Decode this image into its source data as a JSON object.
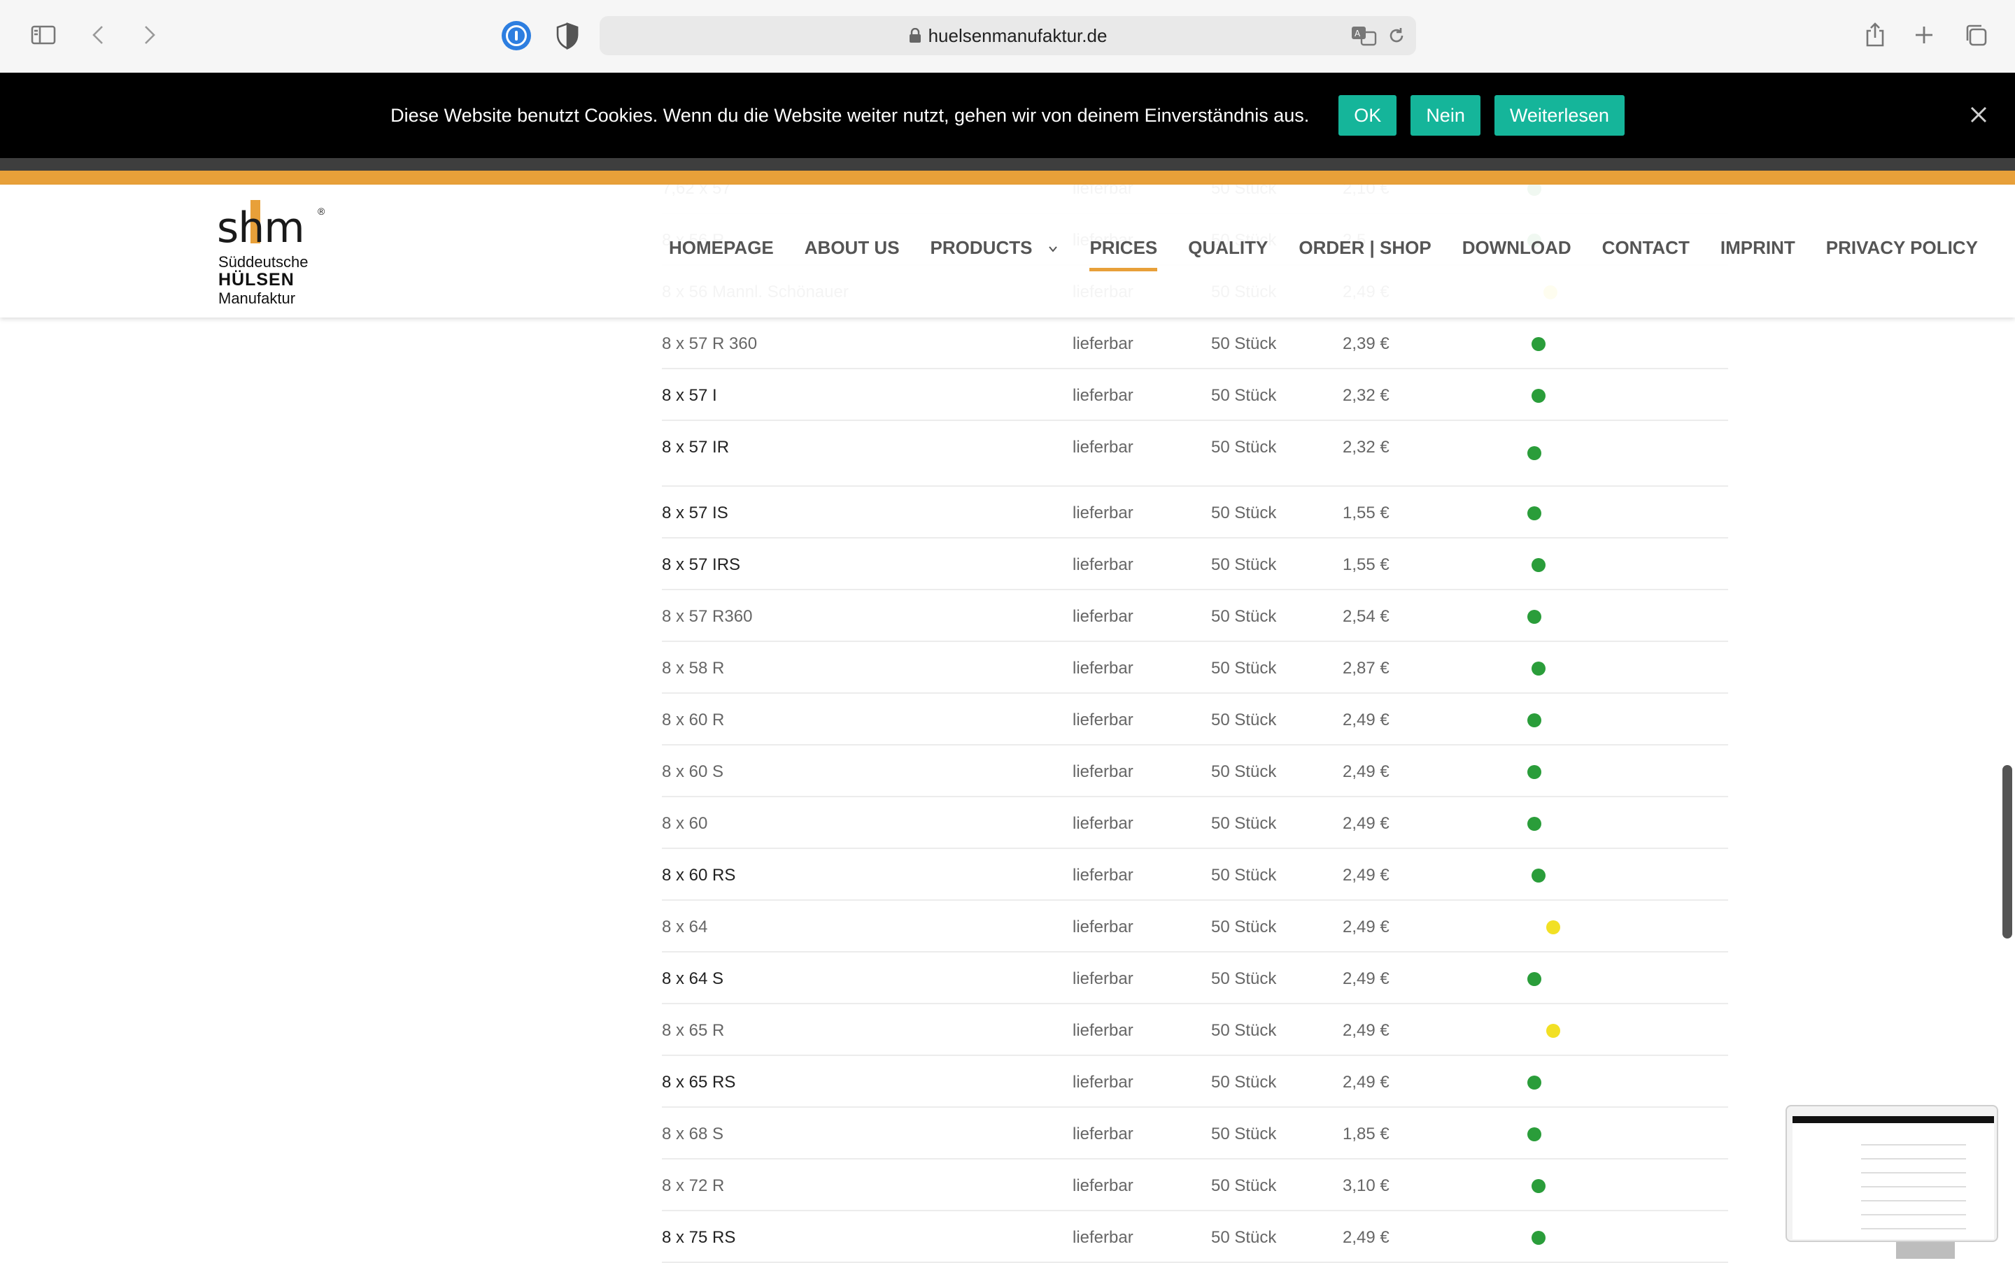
{
  "browser": {
    "url": "huelsenmanufaktur.de"
  },
  "cookie_banner": {
    "message": "Diese Website benutzt Cookies. Wenn du die Website weiter nutzt, gehen wir von deinem Einverständnis aus.",
    "ok_label": "OK",
    "no_label": "Nein",
    "more_label": "Weiterlesen"
  },
  "logo": {
    "mark": "shm",
    "line1": "Süddeutsche",
    "line2": "HÜLSEN",
    "line3": "Manufaktur"
  },
  "nav": {
    "items": [
      "HOMEPAGE",
      "ABOUT US",
      "PRODUCTS",
      "PRICES",
      "QUALITY",
      "ORDER | SHOP",
      "DOWNLOAD",
      "CONTACT",
      "IMPRINT",
      "PRIVACY POLICY"
    ],
    "active": "PRICES"
  },
  "colors": {
    "accent_orange": "#e8a039",
    "cookie_button": "#15b59a",
    "dot_green": "#2a9d3a",
    "dot_yellow": "#f2e024"
  },
  "table": {
    "rows": [
      {
        "name": "7,62 x 57",
        "status": "lieferbar",
        "qty": "50 Stück",
        "price": "2,10 €",
        "dot": "green"
      },
      {
        "name": "8 x 56 R",
        "status": "lieferbar",
        "qty": "50 Stück",
        "price": "2,5",
        "dot": "green"
      },
      {
        "name": "8 x 56 Mannl. Schönauer",
        "status": "lieferbar",
        "qty": "50 Stück",
        "price": "2,49 €",
        "dot": "yellow"
      },
      {
        "name": "8 x 57 R 360",
        "status": "lieferbar",
        "qty": "50 Stück",
        "price": "2,39 €",
        "dot": "green"
      },
      {
        "name": "8 x 57 I",
        "status": "lieferbar",
        "qty": "50 Stück",
        "price": "2,32 €",
        "dot": "green"
      },
      {
        "name": "8 x 57 IR",
        "status": "lieferbar",
        "qty": "50 Stück",
        "price": "2,32 €",
        "dot": "green"
      },
      {
        "name": "8 x 57 IS",
        "status": "lieferbar",
        "qty": "50 Stück",
        "price": "1,55 €",
        "dot": "green"
      },
      {
        "name": "8 x 57 IRS",
        "status": "lieferbar",
        "qty": "50 Stück",
        "price": "1,55 €",
        "dot": "green"
      },
      {
        "name": "8 x 57 R360",
        "status": "lieferbar",
        "qty": "50 Stück",
        "price": "2,54 €",
        "dot": "green"
      },
      {
        "name": "8 x 58 R",
        "status": "lieferbar",
        "qty": "50 Stück",
        "price": "2,87 €",
        "dot": "green"
      },
      {
        "name": "8 x 60 R",
        "status": "lieferbar",
        "qty": "50 Stück",
        "price": "2,49 €",
        "dot": "green"
      },
      {
        "name": "8 x 60 S",
        "status": "lieferbar",
        "qty": "50 Stück",
        "price": "2,49 €",
        "dot": "green"
      },
      {
        "name": "8 x 60",
        "status": "lieferbar",
        "qty": "50 Stück",
        "price": "2,49 €",
        "dot": "green"
      },
      {
        "name": "8 x 60 RS",
        "status": "lieferbar",
        "qty": "50 Stück",
        "price": "2,49 €",
        "dot": "green"
      },
      {
        "name": "8 x 64",
        "status": "lieferbar",
        "qty": "50 Stück",
        "price": "2,49 €",
        "dot": "yellow"
      },
      {
        "name": "8 x 64 S",
        "status": "lieferbar",
        "qty": "50 Stück",
        "price": "2,49 €",
        "dot": "green"
      },
      {
        "name": "8 x 65 R",
        "status": "lieferbar",
        "qty": "50 Stück",
        "price": "2,49 €",
        "dot": "yellow"
      },
      {
        "name": "8 x 65 RS",
        "status": "lieferbar",
        "qty": "50 Stück",
        "price": "2,49 €",
        "dot": "green"
      },
      {
        "name": "8 x 68 S",
        "status": "lieferbar",
        "qty": "50 Stück",
        "price": "1,85 €",
        "dot": "green"
      },
      {
        "name": "8 x 72 R",
        "status": "lieferbar",
        "qty": "50 Stück",
        "price": "3,10 €",
        "dot": "green"
      },
      {
        "name": "8 x 75 RS",
        "status": "lieferbar",
        "qty": "50 Stück",
        "price": "2,49 €",
        "dot": "green"
      }
    ]
  }
}
